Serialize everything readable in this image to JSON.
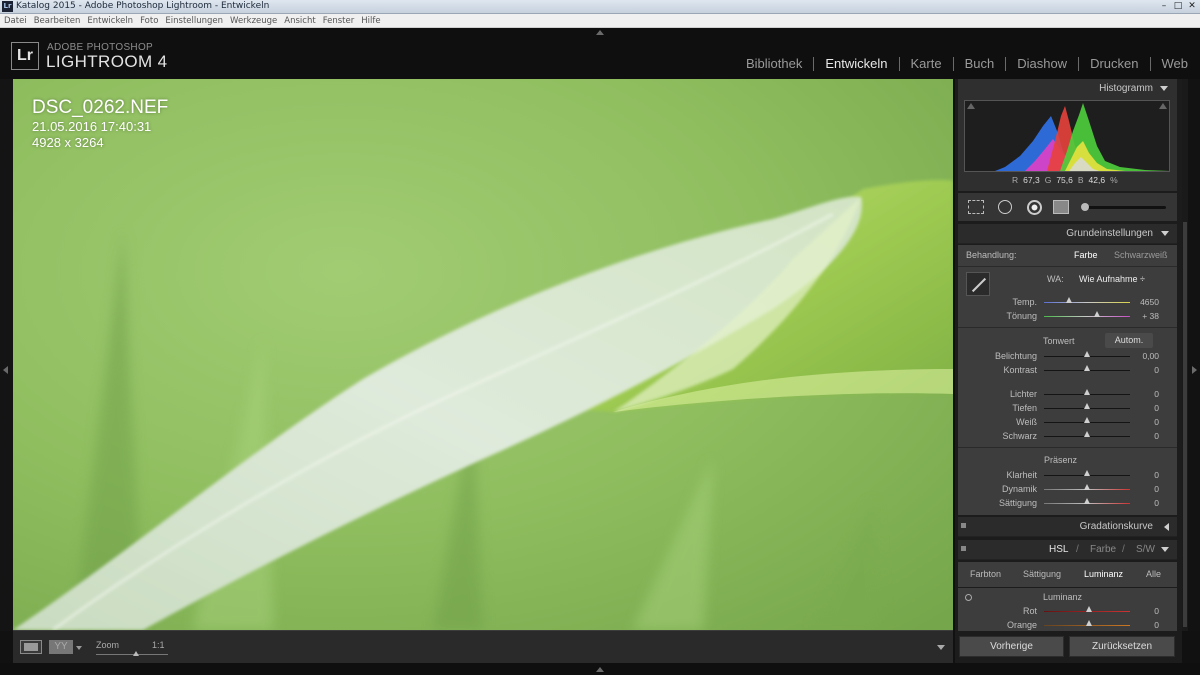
{
  "window": {
    "title": "Katalog 2015 - Adobe Photoshop Lightroom - Entwickeln",
    "app_icon": "Lr",
    "buttons": [
      "minimize-icon",
      "maximize-icon",
      "close-icon"
    ],
    "minimize_glyph": "–",
    "maximize_glyph": "□",
    "close_glyph": "✕"
  },
  "menu": {
    "items": [
      "Datei",
      "Bearbeiten",
      "Entwickeln",
      "Foto",
      "Einstellungen",
      "Werkzeuge",
      "Ansicht",
      "Fenster",
      "Hilfe"
    ]
  },
  "identity": {
    "logo": "Lr",
    "line1": "ADOBE PHOTOSHOP",
    "line2": "LIGHTROOM 4"
  },
  "modules": {
    "items": [
      "Bibliothek",
      "Entwickeln",
      "Karte",
      "Buch",
      "Diashow",
      "Drucken",
      "Web"
    ],
    "active": "Entwickeln"
  },
  "photo": {
    "filename": "DSC_0262.NEF",
    "datetime": "21.05.2016 17:40:31",
    "dimensions": "4928 x 3264"
  },
  "toolbar": {
    "yy_label": "YY",
    "zoom_label": "Zoom",
    "zoom_ratio": "1:1"
  },
  "histogram": {
    "title": "Histogramm",
    "r_label": "R",
    "r_value": "67,3",
    "g_label": "G",
    "g_value": "75,6",
    "b_label": "B",
    "b_value": "42,6",
    "unit": "%"
  },
  "basic": {
    "title": "Grundeinstellungen",
    "treatment_label": "Behandlung:",
    "treatment_color": "Farbe",
    "treatment_bw": "Schwarzweiß",
    "wb_label": "WA:",
    "wb_value": "Wie Aufnahme ÷",
    "temp_label": "Temp.",
    "temp_value": "4650",
    "tint_label": "Tönung",
    "tint_value": "+ 38",
    "tone_label": "Tonwert",
    "auto_label": "Autom.",
    "exposure_label": "Belichtung",
    "exposure_value": "0,00",
    "contrast_label": "Kontrast",
    "contrast_value": "0",
    "highlights_label": "Lichter",
    "highlights_value": "0",
    "shadows_label": "Tiefen",
    "shadows_value": "0",
    "whites_label": "Weiß",
    "whites_value": "0",
    "blacks_label": "Schwarz",
    "blacks_value": "0",
    "presence_label": "Präsenz",
    "clarity_label": "Klarheit",
    "clarity_value": "0",
    "vibrance_label": "Dynamik",
    "vibrance_value": "0",
    "saturation_label": "Sättigung",
    "saturation_value": "0"
  },
  "tone_curve": {
    "title": "Gradationskurve"
  },
  "hsl": {
    "title_hsl": "HSL",
    "sep1": "/",
    "title_color": "Farbe",
    "sep2": "/",
    "title_bw": "S/W",
    "tabs": [
      "Farbton",
      "Sättigung",
      "Luminanz",
      "Alle"
    ],
    "active_tab": "Luminanz",
    "group_label": "Luminanz",
    "red_label": "Rot",
    "red_value": "0",
    "orange_label": "Orange",
    "orange_value": "0"
  },
  "buttons": {
    "previous": "Vorherige",
    "reset": "Zurücksetzen"
  },
  "colors": {
    "accent_text": "#e8e8e8",
    "panel_bg": "#3d3d3d",
    "photo_green": "#8cbf60"
  }
}
